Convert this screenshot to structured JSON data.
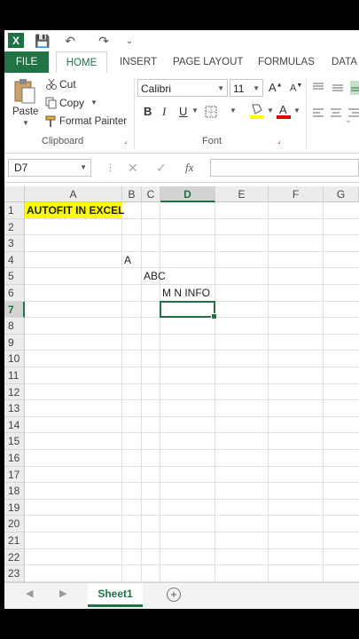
{
  "qat": {
    "logo": "X",
    "save": "💾",
    "undo": "↶",
    "redo": "↷",
    "customize": "⌄"
  },
  "tabs": [
    "FILE",
    "HOME",
    "INSERT",
    "PAGE LAYOUT",
    "FORMULAS",
    "DATA"
  ],
  "clipboard": {
    "paste": "Paste",
    "cut": "Cut",
    "copy": "Copy",
    "format_painter": "Format Painter",
    "group": "Clipboard"
  },
  "font": {
    "name": "Calibri",
    "size": "11",
    "grow": "A",
    "shrink": "A",
    "bold": "B",
    "italic": "I",
    "underline": "U",
    "group": "Font"
  },
  "formula_bar": {
    "name_box": "D7",
    "cancel": "✕",
    "enter": "✓",
    "fx": "fx",
    "value": ""
  },
  "grid": {
    "columns": [
      "A",
      "B",
      "C",
      "D",
      "E",
      "F",
      "G"
    ],
    "rows": [
      "1",
      "2",
      "3",
      "4",
      "5",
      "6",
      "7",
      "8",
      "9",
      "10",
      "11",
      "12",
      "13",
      "14",
      "15",
      "16",
      "17",
      "18",
      "19",
      "20",
      "21",
      "22",
      "23"
    ],
    "cells": {
      "A1": "AUTOFIT IN EXCEL",
      "B4": "A",
      "C5": "ABC",
      "D6": "M N INFO"
    },
    "selected_cell": "D7"
  },
  "sheets": {
    "active": "Sheet1",
    "add": "+"
  },
  "colors": {
    "excel_green": "#217346",
    "highlight": "#ffff00"
  }
}
